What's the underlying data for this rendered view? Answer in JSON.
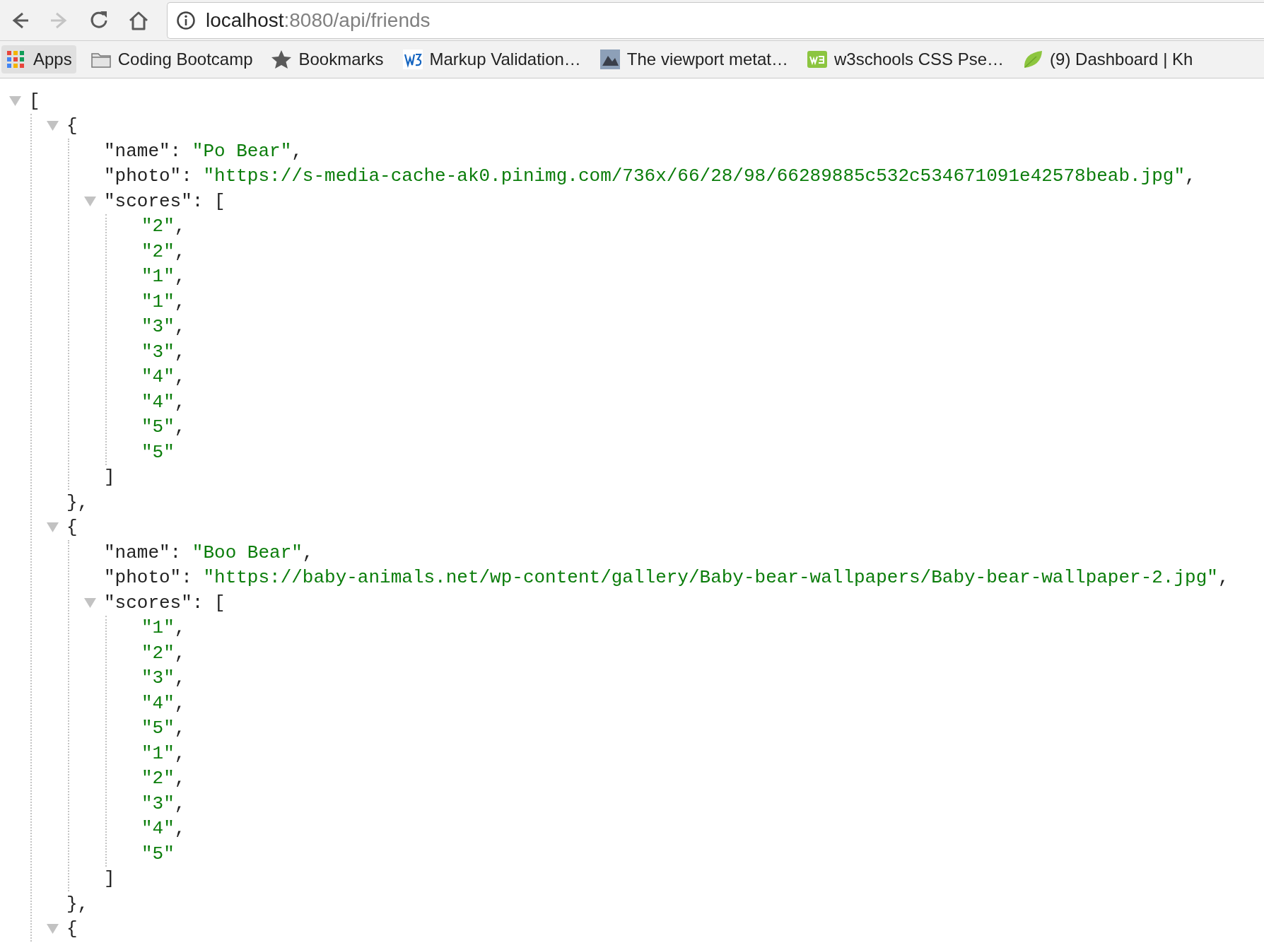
{
  "nav_buttons": [
    {
      "kind": "back",
      "disabled": false
    },
    {
      "kind": "forward",
      "disabled": true
    },
    {
      "kind": "reload",
      "disabled": false
    },
    {
      "kind": "home",
      "disabled": false
    }
  ],
  "address": {
    "host": "localhost",
    "path": ":8080/api/friends"
  },
  "bookmarks": [
    {
      "kind": "apps",
      "label": "Apps",
      "highlighted": true
    },
    {
      "kind": "folder",
      "label": "Coding Bootcamp",
      "highlighted": false
    },
    {
      "kind": "star",
      "label": "Bookmarks",
      "highlighted": false
    },
    {
      "kind": "w3",
      "label": "Markup Validation…",
      "highlighted": false
    },
    {
      "kind": "picture",
      "label": "The viewport metat…",
      "highlighted": false
    },
    {
      "kind": "w3schools",
      "label": "w3schools CSS Pse…",
      "highlighted": false
    },
    {
      "kind": "leaf",
      "label": "(9) Dashboard | Kh",
      "highlighted": false
    }
  ],
  "json_view": {
    "root": {
      "kind": "block",
      "open": "[",
      "expanded": true,
      "children": [
        {
          "kind": "block",
          "open": "{",
          "expanded": true,
          "close": "},",
          "children": [
            {
              "kind": "value",
              "key": "\"name\": ",
              "value": "\"Po Bear\"",
              "comma": ","
            },
            {
              "kind": "value",
              "key": "\"photo\": ",
              "value": "\"https://s-media-cache-ak0.pinimg.com/736x/66/28/98/66289885c532c534671091e42578beab.jpg\"",
              "comma": ","
            },
            {
              "kind": "block",
              "key": "\"scores\": ",
              "open": "[",
              "expanded": true,
              "close": "]",
              "children": [
                {
                  "kind": "value",
                  "value": "\"2\"",
                  "comma": ","
                },
                {
                  "kind": "value",
                  "value": "\"2\"",
                  "comma": ","
                },
                {
                  "kind": "value",
                  "value": "\"1\"",
                  "comma": ","
                },
                {
                  "kind": "value",
                  "value": "\"1\"",
                  "comma": ","
                },
                {
                  "kind": "value",
                  "value": "\"3\"",
                  "comma": ","
                },
                {
                  "kind": "value",
                  "value": "\"3\"",
                  "comma": ","
                },
                {
                  "kind": "value",
                  "value": "\"4\"",
                  "comma": ","
                },
                {
                  "kind": "value",
                  "value": "\"4\"",
                  "comma": ","
                },
                {
                  "kind": "value",
                  "value": "\"5\"",
                  "comma": ","
                },
                {
                  "kind": "value",
                  "value": "\"5\""
                }
              ]
            }
          ]
        },
        {
          "kind": "block",
          "open": "{",
          "expanded": true,
          "close": "},",
          "children": [
            {
              "kind": "value",
              "key": "\"name\": ",
              "value": "\"Boo Bear\"",
              "comma": ","
            },
            {
              "kind": "value",
              "key": "\"photo\": ",
              "value": "\"https://baby-animals.net/wp-content/gallery/Baby-bear-wallpapers/Baby-bear-wallpaper-2.jpg\"",
              "comma": ","
            },
            {
              "kind": "block",
              "key": "\"scores\": ",
              "open": "[",
              "expanded": true,
              "close": "]",
              "children": [
                {
                  "kind": "value",
                  "value": "\"1\"",
                  "comma": ","
                },
                {
                  "kind": "value",
                  "value": "\"2\"",
                  "comma": ","
                },
                {
                  "kind": "value",
                  "value": "\"3\"",
                  "comma": ","
                },
                {
                  "kind": "value",
                  "value": "\"4\"",
                  "comma": ","
                },
                {
                  "kind": "value",
                  "value": "\"5\"",
                  "comma": ","
                },
                {
                  "kind": "value",
                  "value": "\"1\"",
                  "comma": ","
                },
                {
                  "kind": "value",
                  "value": "\"2\"",
                  "comma": ","
                },
                {
                  "kind": "value",
                  "value": "\"3\"",
                  "comma": ","
                },
                {
                  "kind": "value",
                  "value": "\"4\"",
                  "comma": ","
                },
                {
                  "kind": "value",
                  "value": "\"5\""
                }
              ]
            }
          ]
        },
        {
          "kind": "block",
          "open": "{",
          "expanded": true
        }
      ]
    }
  }
}
